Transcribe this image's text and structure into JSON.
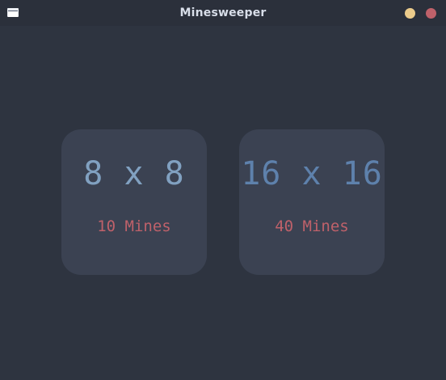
{
  "window": {
    "title": "Minesweeper",
    "icon": "app-window-icon",
    "controls": {
      "minimize_color": "#ebcb8b",
      "close_color": "#bf616a"
    }
  },
  "colors": {
    "background": "#2e3440",
    "card": "#3b4252",
    "size_8": "#81a1c1",
    "size_16": "#5e81ac",
    "mines": "#bf616a"
  },
  "options": [
    {
      "size_label": "8 x 8",
      "mines_label": "10 Mines"
    },
    {
      "size_label": "16 x 16",
      "mines_label": "40 Mines"
    }
  ]
}
